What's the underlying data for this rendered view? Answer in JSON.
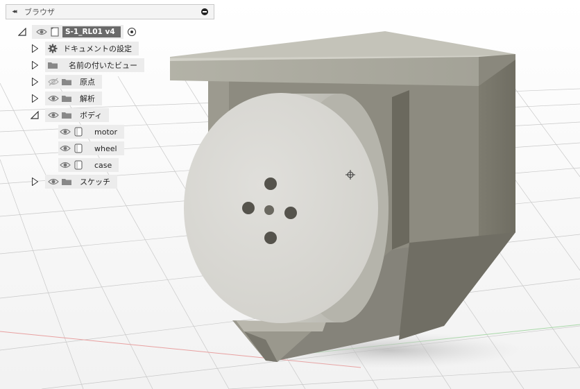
{
  "browser": {
    "title": "ブラウザ",
    "collapse_glyph": "◂◂",
    "root": {
      "label": "S-1_RL01 v4"
    },
    "items": [
      {
        "label": "ドキュメントの設定",
        "icon": "gear-icon"
      },
      {
        "label": "名前の付いたビュー",
        "icon": "folder-icon"
      },
      {
        "label": "原点",
        "icon": "folder-icon",
        "visible": false
      },
      {
        "label": "解析",
        "icon": "folder-icon"
      },
      {
        "label": "ボディ",
        "icon": "folder-icon",
        "expanded": true
      },
      {
        "label": "スケッチ",
        "icon": "folder-icon"
      }
    ],
    "bodies": [
      {
        "label": "motor"
      },
      {
        "label": "wheel"
      },
      {
        "label": "case"
      }
    ]
  },
  "colors": {
    "panel_bg": "#f4f4f4",
    "chip_bg": "#ececec",
    "root_bg": "#6a6a6a",
    "model_gray": "#8a877c",
    "wheel_face": "#d6d5d0"
  }
}
